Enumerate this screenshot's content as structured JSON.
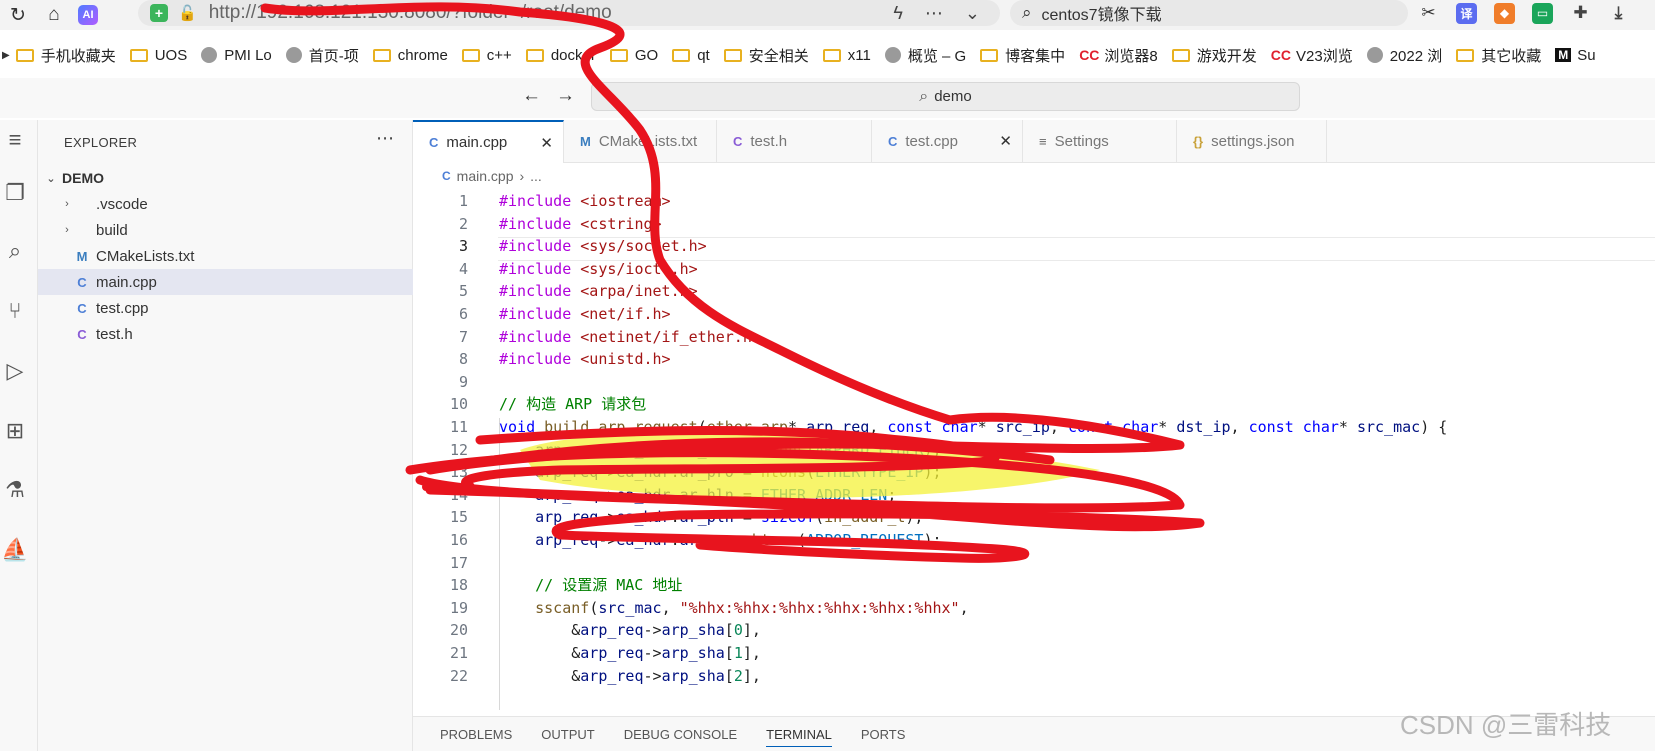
{
  "browser": {
    "url": "http://192.168.121.130:8080/?folder=/root/demo",
    "search_text": "centos7镜像下载",
    "ai_badge": "AI",
    "extension_icons": [
      "scissors-icon",
      "translate-icon",
      "game-icon",
      "book-icon",
      "puzzle-icon",
      "download-icon"
    ],
    "translate_label": "译"
  },
  "bookmarks": [
    {
      "label": "手机收藏夹",
      "icon": "folder"
    },
    {
      "label": "UOS",
      "icon": "folder"
    },
    {
      "label": "PMI Lo",
      "icon": "globe"
    },
    {
      "label": "首页-项",
      "icon": "globe"
    },
    {
      "label": "chrome",
      "icon": "folder"
    },
    {
      "label": "c++",
      "icon": "folder"
    },
    {
      "label": "docker",
      "icon": "folder"
    },
    {
      "label": "GO",
      "icon": "folder"
    },
    {
      "label": "qt",
      "icon": "folder"
    },
    {
      "label": "安全相关",
      "icon": "folder"
    },
    {
      "label": "x11",
      "icon": "folder"
    },
    {
      "label": "概览 – G",
      "icon": "globe"
    },
    {
      "label": "博客集中",
      "icon": "folder"
    },
    {
      "label": "浏览器8",
      "icon": "cc"
    },
    {
      "label": "游戏开发",
      "icon": "folder"
    },
    {
      "label": "V23浏览",
      "icon": "cc"
    },
    {
      "label": "2022 浏",
      "icon": "globe"
    },
    {
      "label": "其它收藏",
      "icon": "folder"
    },
    {
      "label": "Su",
      "icon": "m"
    }
  ],
  "vscode": {
    "command_center": "demo",
    "explorer_title": "EXPLORER",
    "workspace": "DEMO",
    "tree": [
      {
        "label": ".vscode",
        "kind": "folder"
      },
      {
        "label": "build",
        "kind": "folder"
      },
      {
        "label": "CMakeLists.txt",
        "kind": "cmake"
      },
      {
        "label": "main.cpp",
        "kind": "cpp",
        "selected": true
      },
      {
        "label": "test.cpp",
        "kind": "cpp"
      },
      {
        "label": "test.h",
        "kind": "c"
      }
    ],
    "tabs": [
      {
        "label": "main.cpp",
        "icon": "C",
        "active": true
      },
      {
        "label": "CMakeLists.txt",
        "icon": "M"
      },
      {
        "label": "test.h",
        "icon": "C"
      },
      {
        "label": "test.cpp",
        "icon": "C"
      },
      {
        "label": "Settings",
        "icon": "≡"
      },
      {
        "label": "settings.json",
        "icon": "{}"
      }
    ],
    "breadcrumb": [
      "main.cpp",
      "..."
    ],
    "code_lines": [
      "#include <iostream>",
      "#include <cstring>",
      "#include <sys/socket.h>",
      "#include <sys/ioctl.h>",
      "#include <arpa/inet.h>",
      "#include <net/if.h>",
      "#include <netinet/if_ether.h>",
      "#include <unistd.h>",
      "",
      "// 构造 ARP 请求包",
      "void build_arp_request(ether_arp* arp_req, const char* src_ip, const char* dst_ip, const char* src_mac) {",
      "    arp_req->ea_hdr.ar_hrd = htons(ARPHRD_ETHER);",
      "    arp_req->ea_hdr.ar_pro = htons(ETHERTYPE_IP);",
      "    arp_req->ea_hdr.ar_hln = ETHER_ADDR_LEN;",
      "    arp_req->ea_hdr.ar_pln = sizeof(in_addr_t);",
      "    arp_req->ea_hdr.ar_op = htons(ARPOP_REQUEST);",
      "",
      "    // 设置源 MAC 地址",
      "    sscanf(src_mac, \"%hhx:%hhx:%hhx:%hhx:%hhx:%hhx\",",
      "        &arp_req->arp_sha[0],",
      "        &arp_req->arp_sha[1],",
      "        &arp_req->arp_sha[2],"
    ],
    "current_line": 3,
    "panel_tabs": [
      "PROBLEMS",
      "OUTPUT",
      "DEBUG CONSOLE",
      "TERMINAL",
      "PORTS"
    ],
    "active_panel": "TERMINAL"
  },
  "watermark": "CSDN @三雷科技",
  "colors": {
    "accent": "#005fb8",
    "scribble_red": "#e8141e",
    "highlight_yellow": "#f4f13a",
    "keyword": "#af00db",
    "include": "#a31515",
    "comment": "#008000"
  }
}
